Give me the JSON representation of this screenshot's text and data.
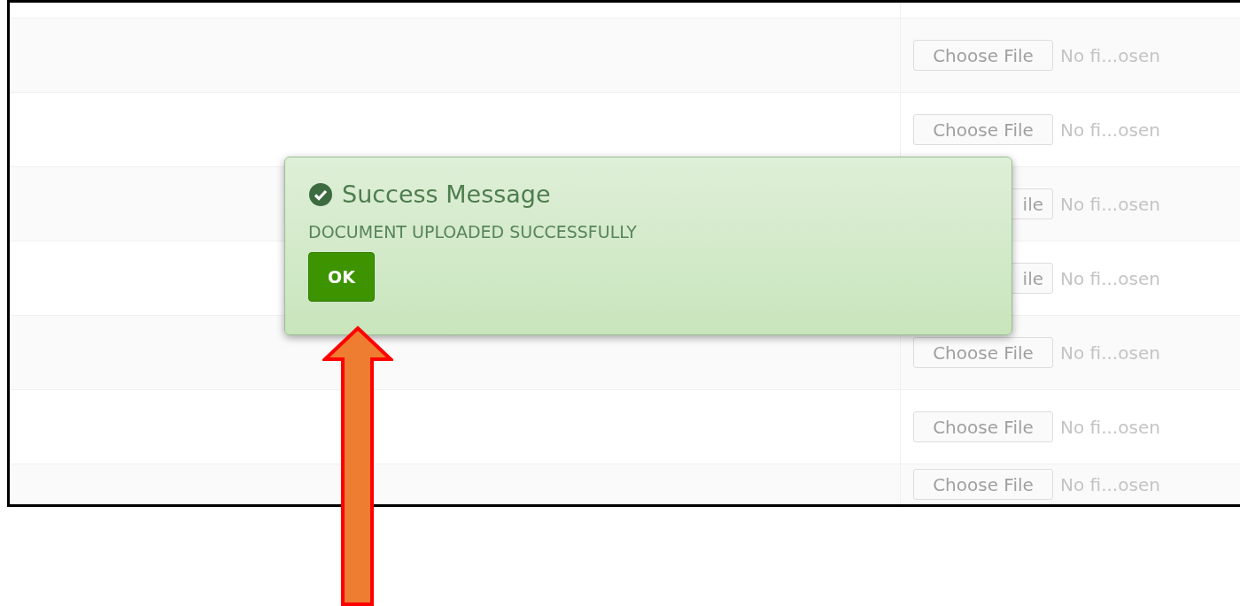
{
  "rows": [
    {
      "file_button": "Choose File",
      "file_status": "No fi...osen",
      "covered": false
    },
    {
      "file_button": "Choose File",
      "file_status": "No fi...osen",
      "covered": false
    },
    {
      "file_button": "ile",
      "file_status": "No fi...osen",
      "covered": true
    },
    {
      "file_button": "ile",
      "file_status": "No fi...osen",
      "covered": true
    },
    {
      "file_button": "Choose File",
      "file_status": "No fi...osen",
      "covered": false
    },
    {
      "file_button": "Choose File",
      "file_status": "No fi...osen",
      "covered": false
    },
    {
      "file_button": "Choose File",
      "file_status": "No fi...osen",
      "covered": false
    }
  ],
  "dialog": {
    "title": "Success Message",
    "message": "DOCUMENT UPLOADED SUCCESSFULLY",
    "button": "OK"
  }
}
